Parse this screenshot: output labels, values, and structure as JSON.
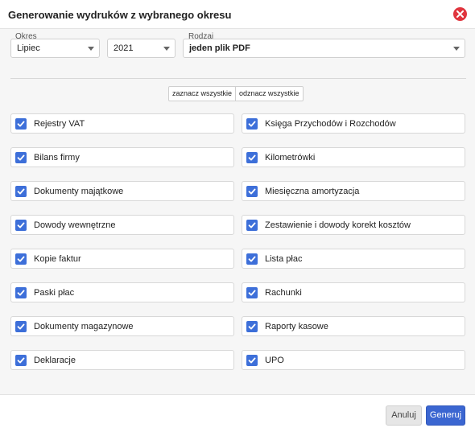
{
  "dialog": {
    "title": "Generowanie wydruków z wybranego okresu"
  },
  "filters": {
    "period_label": "Okres",
    "month_value": "Lipiec",
    "year_value": "2021",
    "type_label": "Rodzaj",
    "type_value": "jeden plik PDF"
  },
  "bulk": {
    "select_all": "zaznacz wszystkie",
    "deselect_all": "odznacz wszystkie"
  },
  "checkboxes": {
    "left": [
      {
        "label": "Rejestry VAT",
        "checked": true
      },
      {
        "label": "Bilans firmy",
        "checked": true
      },
      {
        "label": "Dokumenty majątkowe",
        "checked": true
      },
      {
        "label": "Dowody wewnętrzne",
        "checked": true
      },
      {
        "label": "Kopie faktur",
        "checked": true
      },
      {
        "label": "Paski płac",
        "checked": true
      },
      {
        "label": "Dokumenty magazynowe",
        "checked": true
      },
      {
        "label": "Deklaracje",
        "checked": true
      }
    ],
    "right": [
      {
        "label": "Księga Przychodów i Rozchodów",
        "checked": true
      },
      {
        "label": "Kilometrówki",
        "checked": true
      },
      {
        "label": "Miesięczna amortyzacja",
        "checked": true
      },
      {
        "label": "Zestawienie i dowody korekt kosztów",
        "checked": true
      },
      {
        "label": "Lista płac",
        "checked": true
      },
      {
        "label": "Rachunki",
        "checked": true
      },
      {
        "label": "Raporty kasowe",
        "checked": true
      },
      {
        "label": "UPO",
        "checked": true
      }
    ]
  },
  "footer": {
    "cancel_label": "Anuluj",
    "submit_label": "Generuj"
  },
  "colors": {
    "accent": "#3d6fd9",
    "primary_button": "#3b66d1",
    "close_icon": "#e0353e"
  },
  "icons": {
    "close": "close-circle-icon",
    "dropdown": "chevron-down-icon",
    "check": "checkmark-icon"
  }
}
